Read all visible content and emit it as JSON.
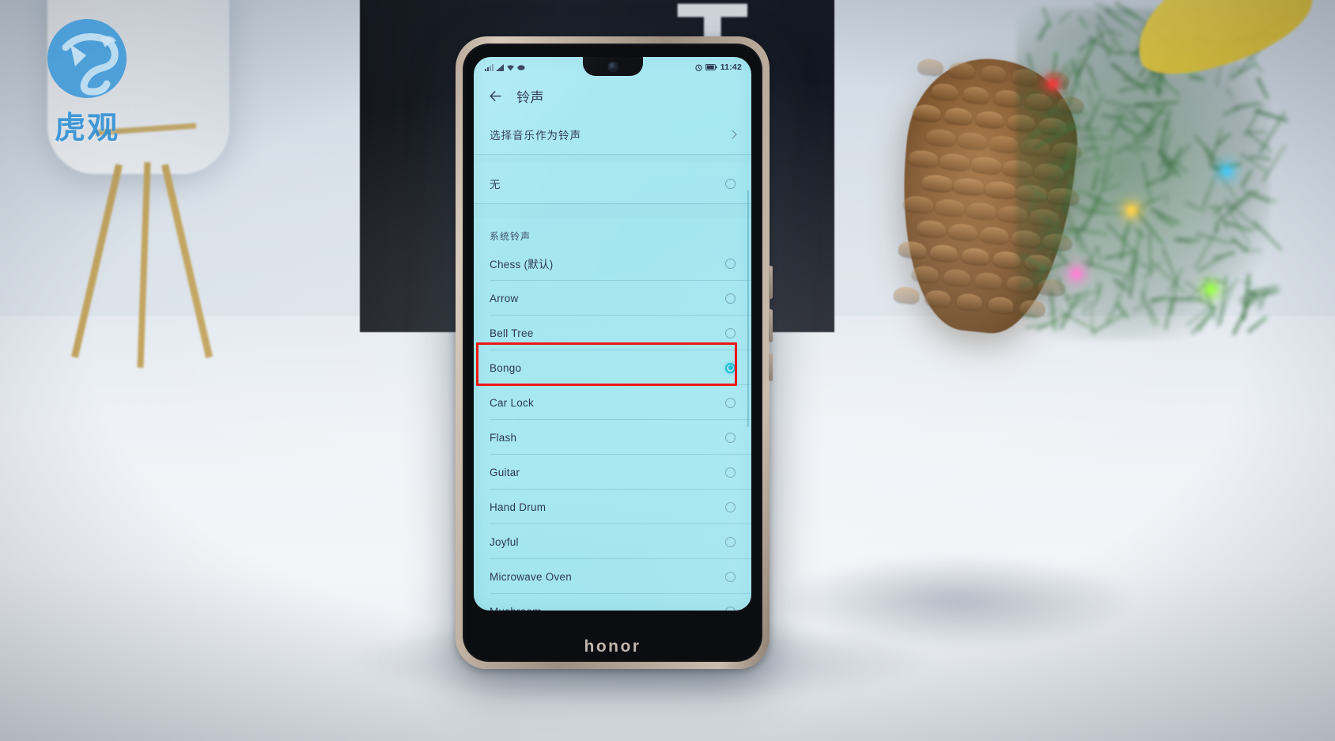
{
  "watermark": {
    "text": "虎观",
    "mark": "tiger-logo"
  },
  "device": {
    "brand_logo": "honor",
    "status_bar": {
      "time": "11:42",
      "left_icons": [
        "signal-icon",
        "signal-icon",
        "wifi-icon",
        "cloud-icon"
      ],
      "right_icons": [
        "alarm-icon",
        "battery-icon"
      ]
    }
  },
  "app": {
    "back_icon": "back-arrow-icon",
    "title": "铃声"
  },
  "top_items": [
    {
      "label": "选择音乐作为铃声",
      "type": "navigate",
      "accessory": "chevron-right-icon"
    },
    {
      "label": "无",
      "type": "radio",
      "selected": false
    }
  ],
  "section": {
    "header": "系统铃声"
  },
  "ringtones": [
    {
      "label": "Chess (默认)",
      "selected": false
    },
    {
      "label": "Arrow",
      "selected": false
    },
    {
      "label": "Bell Tree",
      "selected": false
    },
    {
      "label": "Bongo",
      "selected": true
    },
    {
      "label": "Car Lock",
      "selected": false
    },
    {
      "label": "Flash",
      "selected": false
    },
    {
      "label": "Guitar",
      "selected": false
    },
    {
      "label": "Hand Drum",
      "selected": false
    },
    {
      "label": "Joyful",
      "selected": false
    },
    {
      "label": "Microwave Oven",
      "selected": false
    },
    {
      "label": "Mushroom",
      "selected": false
    }
  ],
  "annotation": {
    "shape": "rectangle",
    "color": "#f01515",
    "targets": "Bongo"
  },
  "colors": {
    "screen_bg": "#a6e7f0",
    "accent": "#0fb8d4",
    "text": "#2b3652",
    "annotation": "#f01515",
    "watermark": "#2c8fd6"
  }
}
